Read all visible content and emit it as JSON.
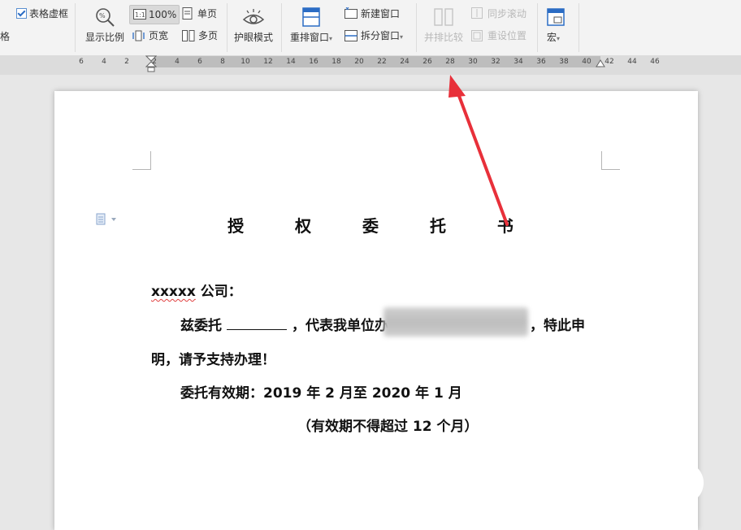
{
  "ribbon": {
    "table_outline_label": "表格虚框",
    "grid_label": "格",
    "zoom_label": "显示比例",
    "zoom_value": "100%",
    "single_page_label": "单页",
    "page_width_label": "页宽",
    "multi_page_label": "多页",
    "eye_protect_label": "护眼模式",
    "rearrange_label": "重排窗口",
    "new_window_label": "新建窗口",
    "split_window_label": "拆分窗口",
    "side_by_side_label": "并排比较",
    "sync_scroll_label": "同步滚动",
    "reset_position_label": "重设位置",
    "macro_label": "宏"
  },
  "ruler": {
    "ticks": [
      "6",
      "4",
      "2",
      "2",
      "4",
      "6",
      "8",
      "10",
      "12",
      "14",
      "16",
      "18",
      "20",
      "22",
      "24",
      "26",
      "28",
      "30",
      "32",
      "34",
      "36",
      "38",
      "40",
      "42",
      "44",
      "46"
    ]
  },
  "document": {
    "title": "授 权 委 托 书",
    "addressee_prefix": "xxxxx",
    "addressee_suffix": " 公司：",
    "line1_a": "兹委托",
    "line1_b": "，代表我单位办",
    "line1_c": "，特此申",
    "line2": "明，请予支持办理！",
    "line3": "委托有效期：2019 年 2 月至 2020 年 1 月",
    "line4": "（有效期不得超过 12 个月）"
  },
  "colors": {
    "arrow": "#e8303a",
    "accent": "#2b6cc4"
  }
}
